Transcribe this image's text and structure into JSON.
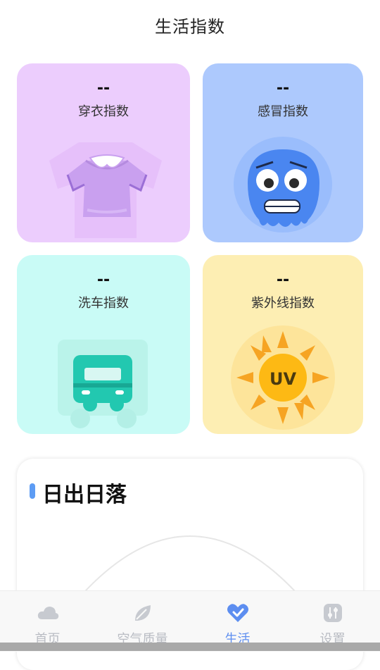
{
  "header": {
    "title": "生活指数"
  },
  "cards": {
    "clothes": {
      "value": "--",
      "label": "穿衣指数"
    },
    "cold": {
      "value": "--",
      "label": "感冒指数"
    },
    "carwash": {
      "value": "--",
      "label": "洗车指数"
    },
    "uv": {
      "value": "--",
      "label": "紫外线指数",
      "badge": "UV"
    }
  },
  "sunrise": {
    "title": "日出日落"
  },
  "tabbar": {
    "items": [
      {
        "label": "首页",
        "icon": "cloud-icon"
      },
      {
        "label": "空气质量",
        "icon": "leaf-icon"
      },
      {
        "label": "生活",
        "icon": "heart-check-icon",
        "active": true
      },
      {
        "label": "设置",
        "icon": "settings-icon"
      }
    ]
  },
  "colors": {
    "accent": "#5d8ef0",
    "clothes_bg": "#eccdfd",
    "cold_bg": "#adc9fd",
    "carwash_bg": "#c9fbf6",
    "uv_bg": "#fdeeb3"
  }
}
